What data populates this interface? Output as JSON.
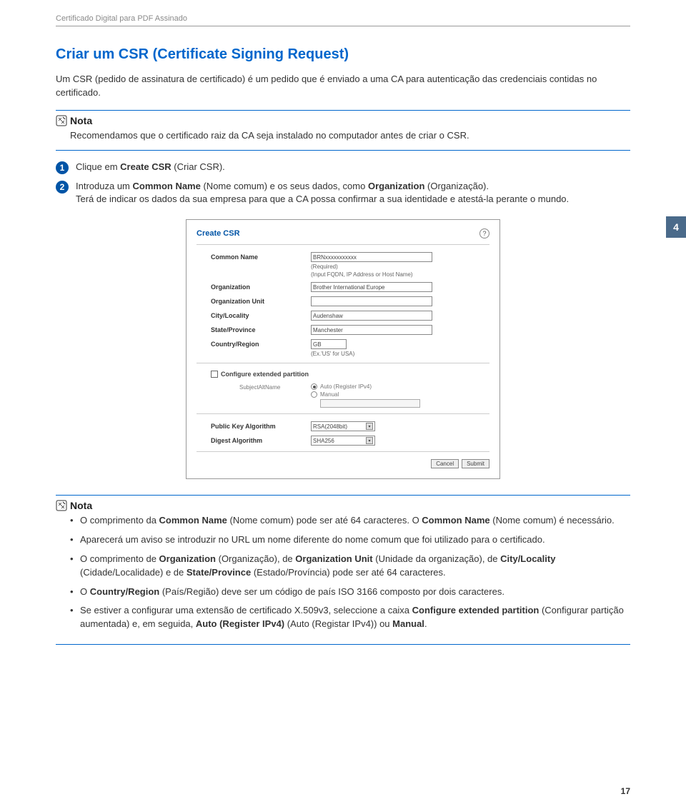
{
  "breadcrumb": "Certificado Digital para PDF Assinado",
  "heading": "Criar um CSR (Certificate Signing Request)",
  "intro": "Um CSR (pedido de assinatura de certificado) é um pedido que é enviado a uma CA para autenticação das credenciais contidas no certificado.",
  "nota_label": "Nota",
  "nota1_text": "Recomendamos que o certificado raiz da CA seja instalado no computador antes de criar o CSR.",
  "step1_pre": "Clique em ",
  "step1_bold": "Create CSR",
  "step1_post": " (Criar CSR).",
  "step2_pre": "Introduza um ",
  "step2_b1": "Common Name",
  "step2_mid1": " (Nome comum) e os seus dados, como ",
  "step2_b2": "Organization",
  "step2_mid2": " (Organização).",
  "step2_line2": "Terá de indicar os dados da sua empresa para que a CA possa confirmar a sua identidade e atestá-la perante o mundo.",
  "page_tab": "4",
  "page_num": "17",
  "ss": {
    "title": "Create CSR",
    "help": "?",
    "common_name_label": "Common Name",
    "common_name_value": "BRNxxxxxxxxxxx",
    "required": "(Required)",
    "fqdn_hint": "(Input FQDN, IP Address or Host Name)",
    "org_label": "Organization",
    "org_value": "Brother International Europe",
    "ou_label": "Organization Unit",
    "city_label": "City/Locality",
    "city_value": "Audenshaw",
    "state_label": "State/Province",
    "state_value": "Manchester",
    "country_label": "Country/Region",
    "country_value": "GB",
    "country_hint": "(Ex.'US' for USA)",
    "configure_ext": "Configure extended partition",
    "subj_alt": "SubjectAltName",
    "auto_radio": "Auto (Register IPv4)",
    "manual_radio": "Manual",
    "pubkey_label": "Public Key Algorithm",
    "pubkey_value": "RSA(2048bit)",
    "digest_label": "Digest Algorithm",
    "digest_value": "SHA256",
    "cancel": "Cancel",
    "submit": "Submit"
  },
  "nota2": {
    "b1_pre": "O comprimento da ",
    "b1_b1": "Common Name",
    "b1_mid": " (Nome comum) pode ser até 64 caracteres. O ",
    "b1_b2": "Common Name",
    "b1_post": " (Nome comum) é necessário.",
    "b2": "Aparecerá um aviso se introduzir no URL um nome diferente do nome comum que foi utilizado para o certificado.",
    "b3_pre": "O comprimento de ",
    "b3_b1": "Organization",
    "b3_m1": " (Organização), de ",
    "b3_b2": "Organization Unit",
    "b3_m2": " (Unidade da organização), de ",
    "b3_b3": "City/Locality",
    "b3_m3": " (Cidade/Localidade) e de ",
    "b3_b4": "State/Province",
    "b3_m4": " (Estado/Província) pode ser até 64 caracteres.",
    "b4_pre": "O ",
    "b4_b1": "Country/Region",
    "b4_post": " (País/Região) deve ser um código de país ISO 3166 composto por dois caracteres.",
    "b5_pre": "Se estiver a configurar uma extensão de certificado X.509v3, seleccione a caixa ",
    "b5_b1": "Configure extended partition",
    "b5_m1": " (Configurar partição aumentada) e, em seguida, ",
    "b5_b2": "Auto (Register IPv4)",
    "b5_m2": " (Auto (Registar IPv4)) ou ",
    "b5_b3": "Manual",
    "b5_post": "."
  }
}
